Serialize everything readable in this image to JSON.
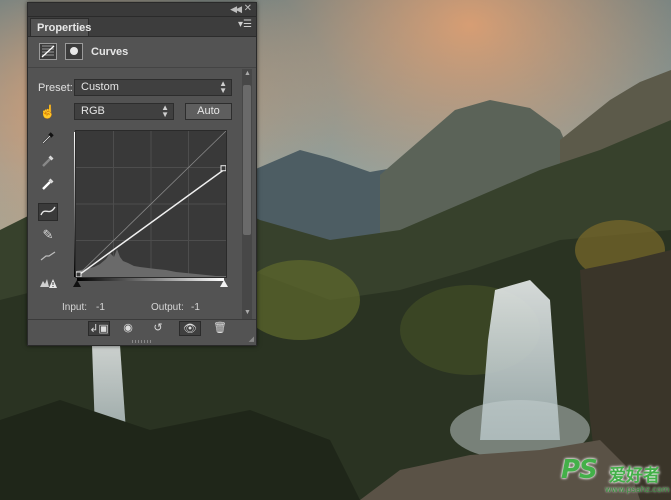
{
  "panel": {
    "tab_label": "Properties",
    "title": "Curves",
    "preset": {
      "label": "Preset:",
      "value": "Custom"
    },
    "channel": {
      "value": "RGB"
    },
    "auto_label": "Auto",
    "input": {
      "label": "Input:",
      "value": "-1"
    },
    "output": {
      "label": "Output:",
      "value": "-1"
    },
    "tools": [
      "on-image-adjust-icon",
      "eyedropper-black-icon",
      "eyedropper-gray-icon",
      "eyedropper-white-icon",
      "curve-points-icon",
      "pencil-icon",
      "smooth-icon",
      "clipping-warning-icon"
    ],
    "bottom_buttons": [
      "clip-to-layer-icon",
      "view-previous-icon",
      "reset-icon",
      "visibility-icon",
      "delete-icon"
    ]
  },
  "curve": {
    "points": [
      [
        0,
        0
      ],
      [
        255,
        190
      ]
    ],
    "input_range": [
      0,
      255
    ],
    "output_range": [
      0,
      255
    ]
  },
  "watermark": {
    "logo": "PS",
    "cn": "爱好者",
    "url": "www.psahz.com"
  },
  "colors": {
    "panel": "#535353",
    "graph_bg": "#393939",
    "curve_line": "#f0f0f0"
  }
}
